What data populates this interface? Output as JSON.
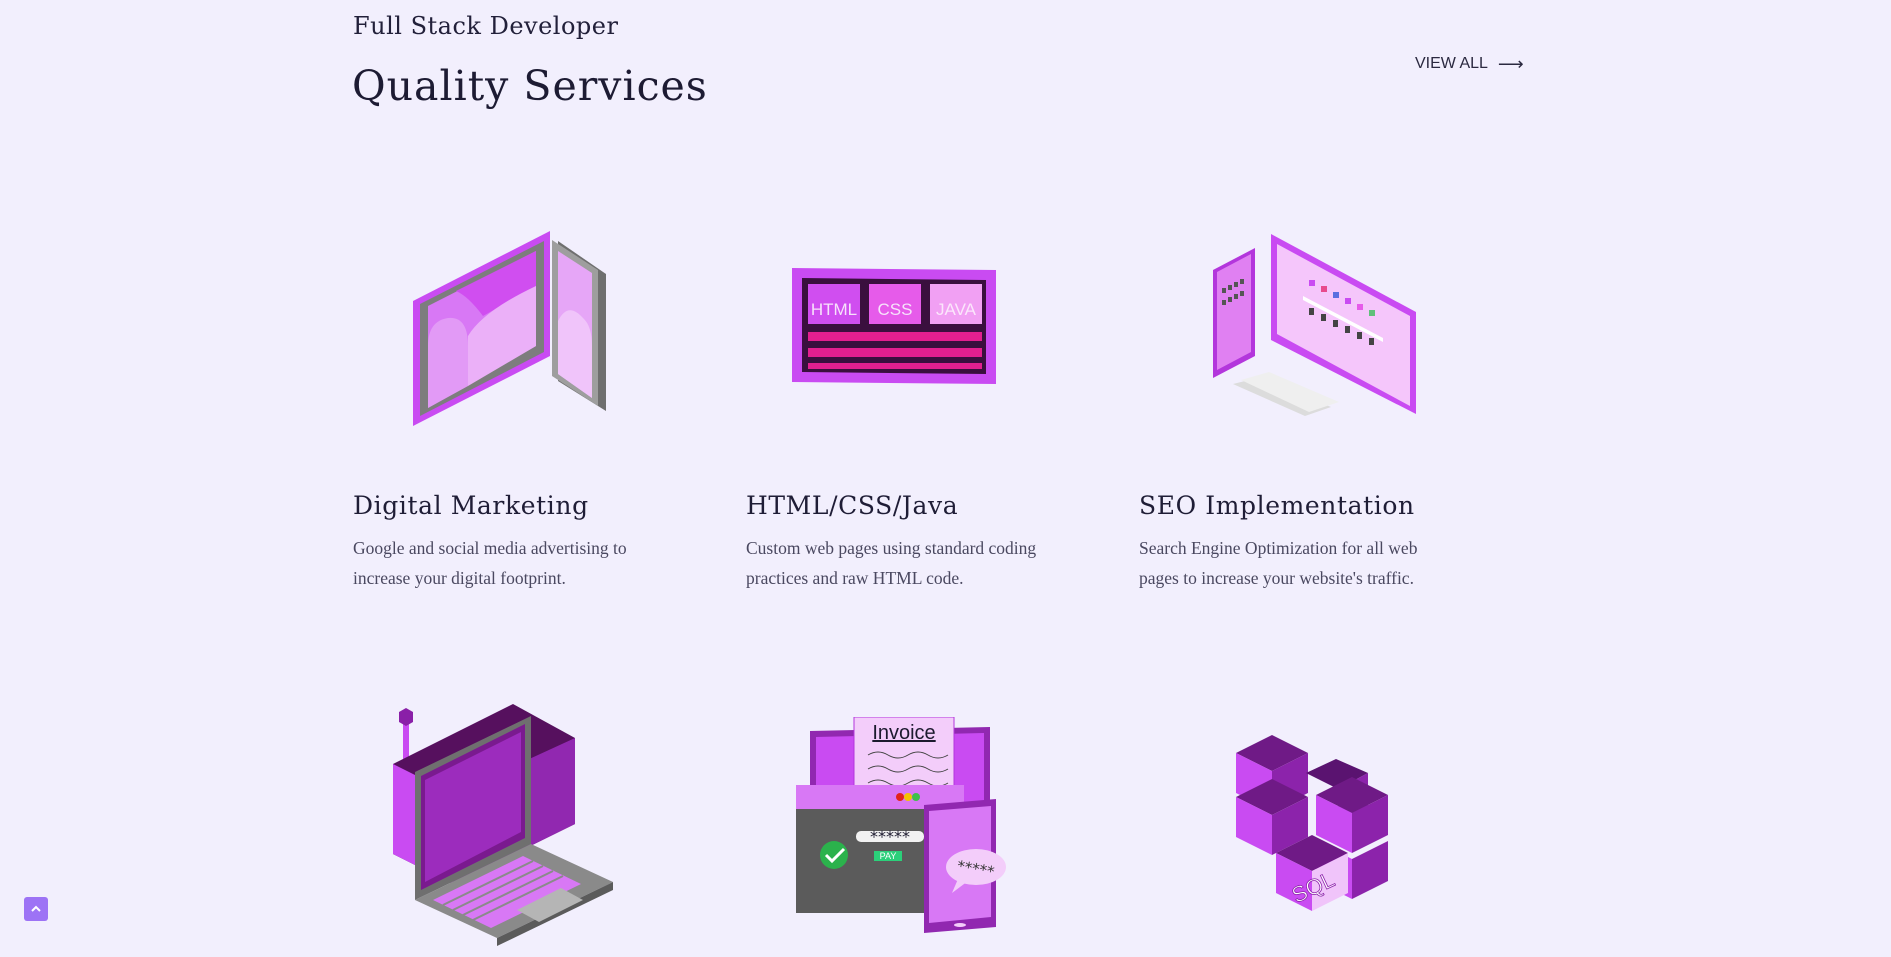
{
  "header": {
    "eyebrow": "Full Stack Developer",
    "title": "Quality Services",
    "view_all_label": "VIEW ALL",
    "view_all_icon": "arrow-right-icon"
  },
  "services": [
    {
      "title": "Digital Marketing",
      "description": "Google and social media advertising to increase your digital footprint.",
      "icon": "tablet-screens-icon"
    },
    {
      "title": "HTML/CSS/Java",
      "description": "Custom web pages using standard coding practices and raw HTML code.",
      "icon": "code-monitor-icon",
      "art_labels": [
        "HTML",
        "CSS",
        "JAVA"
      ]
    },
    {
      "title": "SEO Implementation",
      "description": "Search Engine Optimization for all web pages to increase your website's traffic.",
      "icon": "seo-screens-icon"
    },
    {
      "icon": "laptop-server-icon"
    },
    {
      "icon": "invoice-payment-icon",
      "art_labels": [
        "Invoice",
        "*****",
        "PAY",
        "*****"
      ]
    },
    {
      "icon": "sql-cubes-icon",
      "art_labels": [
        "SQL"
      ]
    }
  ],
  "scroll_top": {
    "icon": "chevron-up-icon"
  },
  "colors": {
    "background": "#f2effd",
    "accent": "#9d73f5",
    "purple": "#c94bf2"
  }
}
